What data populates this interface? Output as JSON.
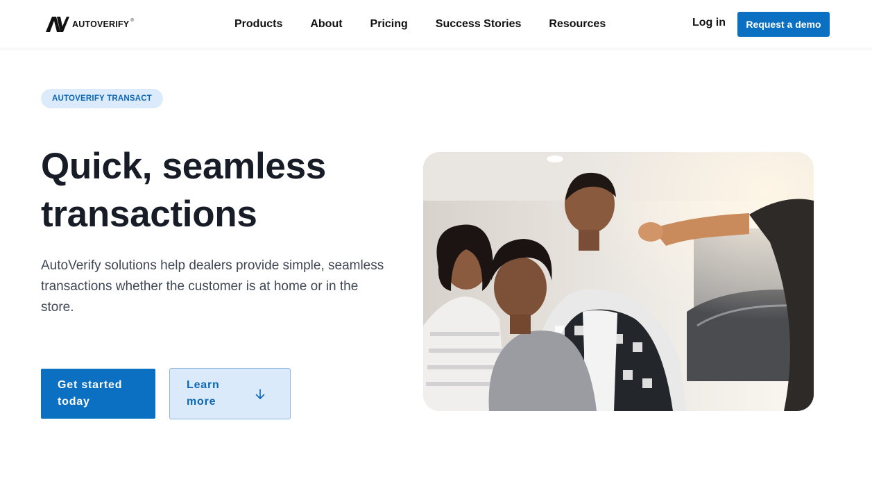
{
  "header": {
    "logo_text": "AUTOVERIFY",
    "logo_reg": "®",
    "nav": [
      {
        "label": "Products"
      },
      {
        "label": "About"
      },
      {
        "label": "Pricing"
      },
      {
        "label": "Success Stories"
      },
      {
        "label": "Resources"
      }
    ],
    "login_label": "Log in",
    "demo_label": "Request a demo"
  },
  "hero": {
    "badge": "AUTOVERIFY TRANSACT",
    "headline_line1": "Quick, seamless",
    "headline_line2": "transactions",
    "subtext": "AutoVerify solutions help dealers provide simple, seamless transactions whether the customer is at home or in the store.",
    "primary_cta": "Get started today",
    "secondary_cta": "Learn more"
  },
  "colors": {
    "brand_blue": "#0b6fc2",
    "badge_bg": "#dcebfb",
    "secondary_bg": "#dbeafa"
  },
  "icons": [
    "autoverify-logo-icon",
    "arrow-down-icon"
  ]
}
